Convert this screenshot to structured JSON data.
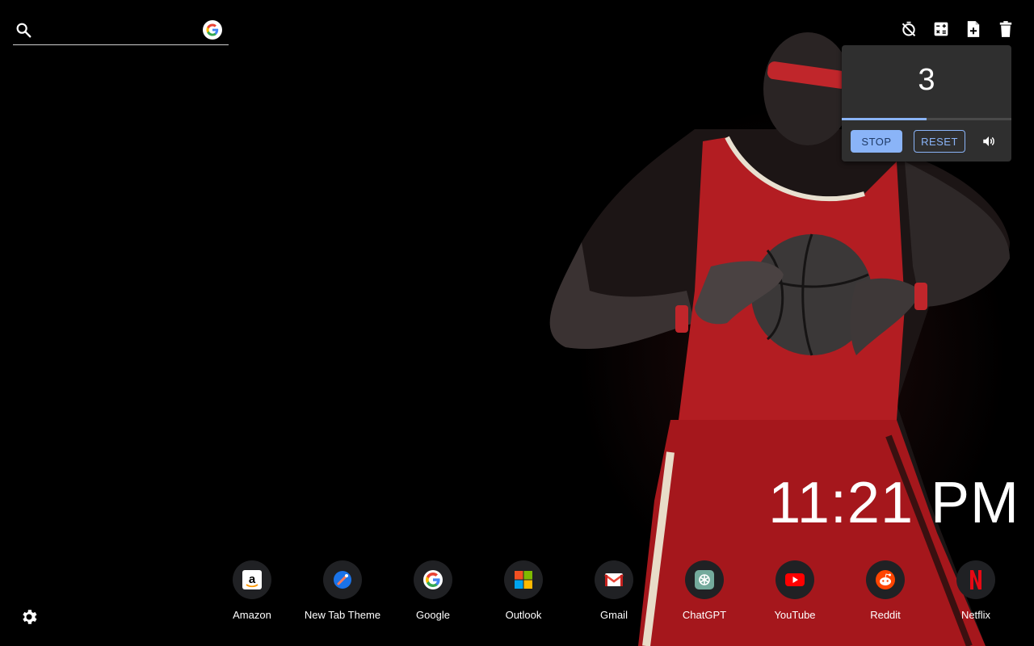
{
  "search": {
    "placeholder": "",
    "value": "",
    "engine_icon": "google-logo-icon"
  },
  "toolbar": {
    "items": [
      {
        "name": "timer-off-icon"
      },
      {
        "name": "calculator-icon"
      },
      {
        "name": "note-add-icon"
      },
      {
        "name": "trash-icon"
      }
    ]
  },
  "timer": {
    "count": "3",
    "progress": 0.5,
    "stop_label": "STOP",
    "reset_label": "RESET",
    "volume_icon": "volume-icon"
  },
  "clock": {
    "time": "11:21 PM"
  },
  "shortcuts": [
    {
      "label": "Amazon",
      "icon": "amazon-icon"
    },
    {
      "label": "New Tab Theme",
      "icon": "new-tab-theme-icon"
    },
    {
      "label": "Google",
      "icon": "google-icon"
    },
    {
      "label": "Outlook",
      "icon": "outlook-icon"
    },
    {
      "label": "Gmail",
      "icon": "gmail-icon"
    },
    {
      "label": "ChatGPT",
      "icon": "chatgpt-icon"
    },
    {
      "label": "YouTube",
      "icon": "youtube-icon"
    },
    {
      "label": "Reddit",
      "icon": "reddit-icon"
    },
    {
      "label": "Netflix",
      "icon": "netflix-icon"
    }
  ],
  "colors": {
    "background": "#000000",
    "accent": "#8ab4f8",
    "panel": "#2f2f2f",
    "shortcut_bg": "#202124"
  }
}
